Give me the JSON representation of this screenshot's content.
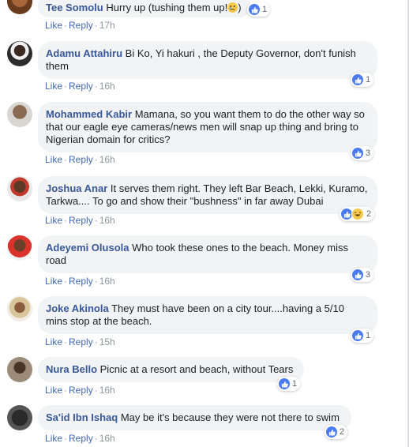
{
  "comments": [
    {
      "author": "Tee Somolu",
      "text": "Hurry up (tushing them up!",
      "emoji": "crying-face",
      "reaction_count": "1",
      "action_like": "Like",
      "action_reply": "Reply",
      "time": "17h"
    },
    {
      "author": "Adamu Attahiru",
      "text": "Bi Ko, Yi hakuri , the Deputy Governor, don't funish them",
      "reaction_count": "1",
      "action_like": "Like",
      "action_reply": "Reply",
      "time": "16h"
    },
    {
      "author": "Mohammed Kabir",
      "text": "Mamana, so you want them to do the other way so that our eagle eye cameras/news men will snap up thing and bring to Nigerian domain for critics?",
      "reaction_count": "3",
      "action_like": "Like",
      "action_reply": "Reply",
      "time": "16h"
    },
    {
      "author": "Joshua Anar",
      "text": "It serves them right. They left Bar Beach, Lekki, Kuramo, Tarkwa.... To go and show their \"bushness\" in far away Dubai",
      "reaction_count": "2",
      "action_like": "Like",
      "action_reply": "Reply",
      "time": "16h"
    },
    {
      "author": "Adeyemi Olusola",
      "text": "Who took these ones to the beach. Money miss road",
      "reaction_count": "3",
      "action_like": "Like",
      "action_reply": "Reply",
      "time": "16h"
    },
    {
      "author": "Joke Akinola",
      "text": "They must have been on a city tour....having a 5/10 mins stop at the beach.",
      "reaction_count": "1",
      "action_like": "Like",
      "action_reply": "Reply",
      "time": "15h"
    },
    {
      "author": "Nura Bello",
      "text": "Picnic at a resort and beach, without Tears",
      "reaction_count": "1",
      "action_like": "Like",
      "action_reply": "Reply",
      "time": "16h"
    },
    {
      "author": "Sa'id Ibn Ishaq",
      "text": "May be it's because they were not there to swim",
      "reaction_count": "2",
      "action_like": "Like",
      "action_reply": "Reply",
      "time": "16h"
    }
  ],
  "icons": {
    "like": "like-icon",
    "haha": "haha-icon"
  },
  "colors": {
    "author": "#385898",
    "link": "#4267b2",
    "bubble": "#f2f3f5",
    "like_blue": "#4b7bf0"
  }
}
